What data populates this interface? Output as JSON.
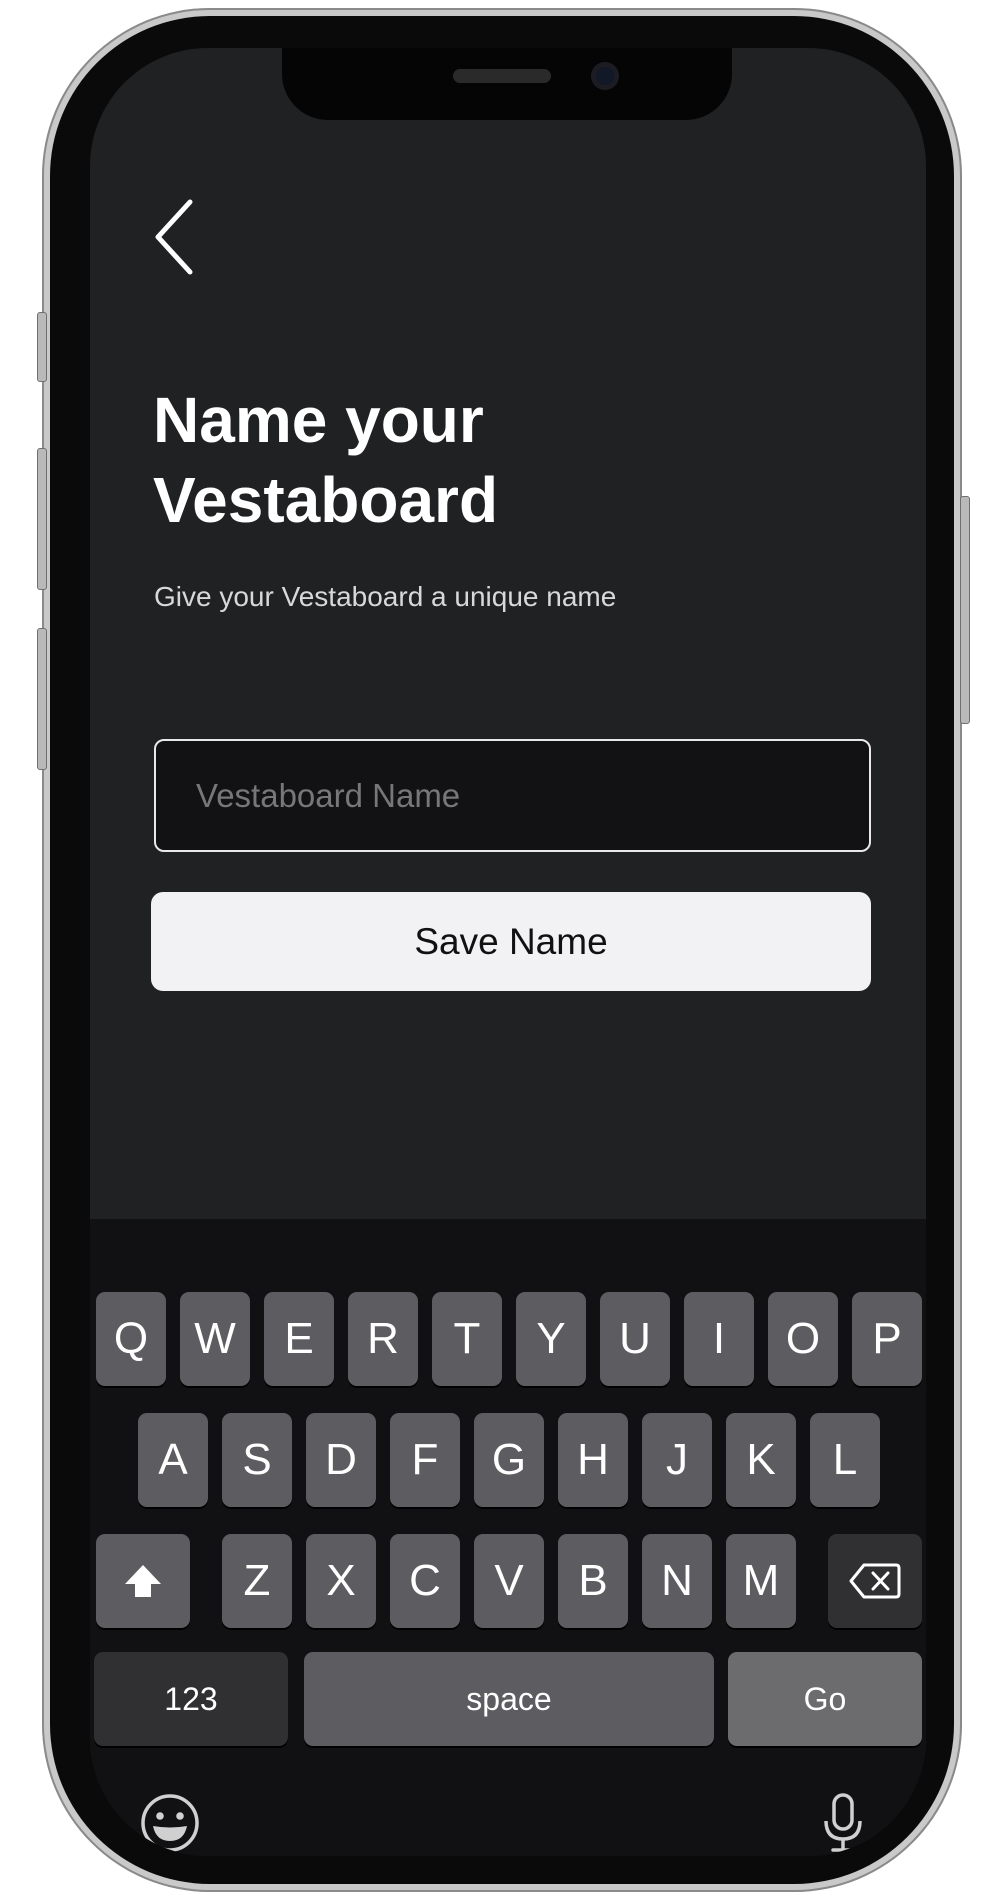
{
  "screen": {
    "back_icon": "chevron-left-icon",
    "title": "Name your\nVestaboard",
    "subtitle": "Give your Vestaboard a unique name",
    "name_input": {
      "placeholder": "Vestaboard Name",
      "value": ""
    },
    "save_button": "Save Name"
  },
  "keyboard": {
    "row1": [
      "Q",
      "W",
      "E",
      "R",
      "T",
      "Y",
      "U",
      "I",
      "O",
      "P"
    ],
    "row2": [
      "A",
      "S",
      "D",
      "F",
      "G",
      "H",
      "J",
      "K",
      "L"
    ],
    "row3": [
      "Z",
      "X",
      "C",
      "V",
      "B",
      "N",
      "M"
    ],
    "shift_icon": "shift-arrow-icon",
    "delete_icon": "backspace-icon",
    "numbers_key": "123",
    "space_key": "space",
    "go_key": "Go",
    "emoji_icon": "emoji-icon",
    "mic_icon": "microphone-icon"
  },
  "colors": {
    "screen_bg": "#202123",
    "keyboard_bg": "#111113",
    "key_bg": "#5d5d61",
    "button_bg": "#f2f2f4",
    "text_primary": "#ffffff"
  }
}
